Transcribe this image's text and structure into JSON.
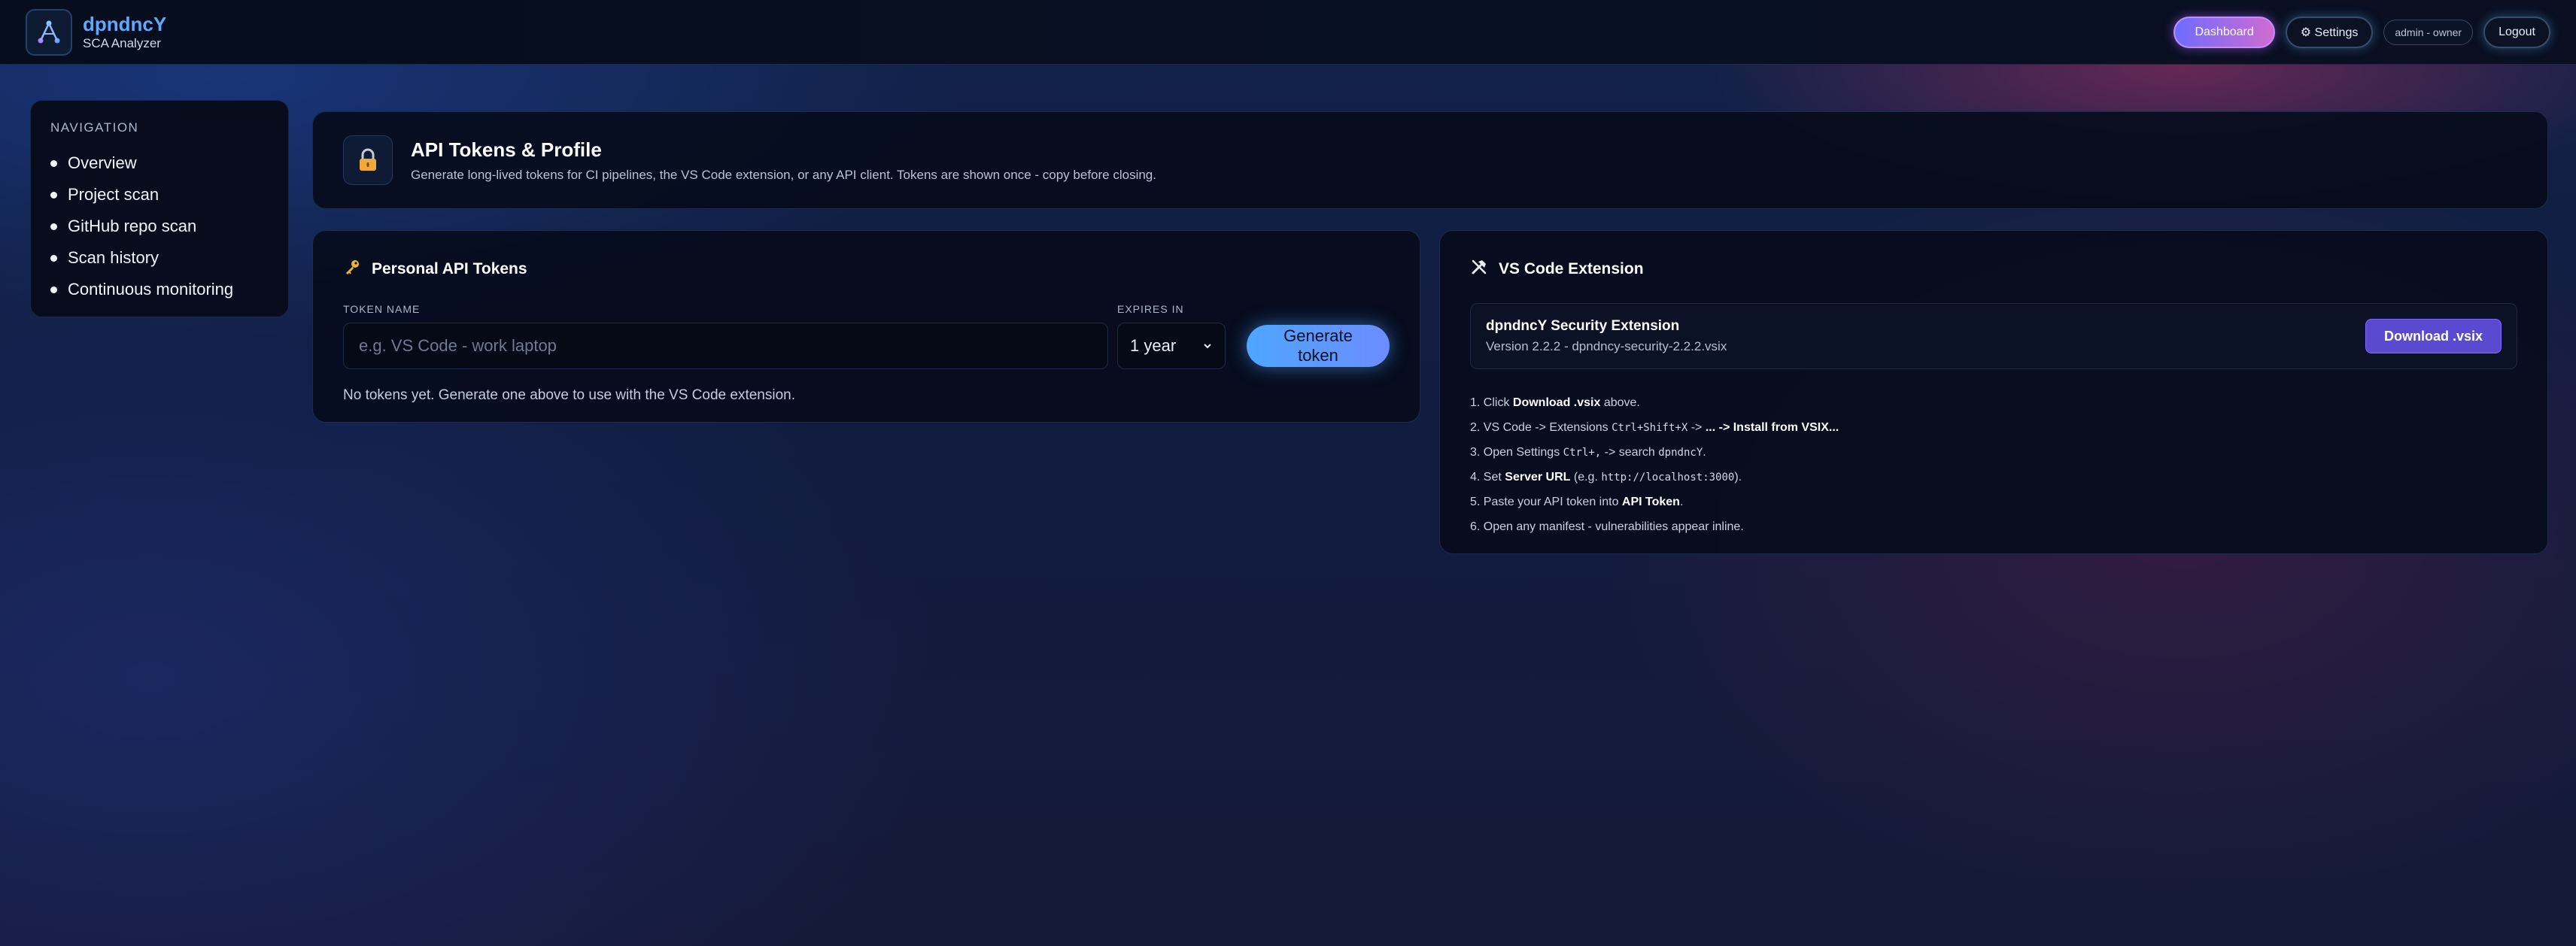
{
  "app": {
    "name": "dpndncY",
    "subtitle": "SCA Analyzer",
    "accent_color": "#5ea8ff"
  },
  "header_actions": {
    "dashboard_label": "Dashboard",
    "settings_label": "⚙ Settings",
    "user_label": "admin - owner",
    "logout_label": "Logout"
  },
  "sidebar": {
    "heading": "NAVIGATION",
    "items": [
      {
        "label": "Overview"
      },
      {
        "label": "Project scan"
      },
      {
        "label": "GitHub repo scan"
      },
      {
        "label": "Scan history"
      },
      {
        "label": "Continuous monitoring"
      }
    ]
  },
  "page_header": {
    "icon": "lock-icon",
    "title": "API Tokens & Profile",
    "subtitle": "Generate long-lived tokens for CI pipelines, the VS Code extension, or any API client. Tokens are shown once - copy before closing."
  },
  "tokens_panel": {
    "icon": "key-icon",
    "title": "Personal API Tokens",
    "token_name_label": "TOKEN NAME",
    "token_name_placeholder": "e.g. VS Code - work laptop",
    "token_name_value": "",
    "expires_label": "EXPIRES IN",
    "expires_value": "1 year",
    "generate_label": "Generate token",
    "empty_text": "No tokens yet. Generate one above to use with the VS Code extension."
  },
  "vscode_panel": {
    "icon": "tools-icon",
    "title": "VS Code Extension",
    "extension_name": "dpndncY Security Extension",
    "extension_version": "Version 2.2.2 - dpndncy-security-2.2.2.vsix",
    "download_label": "Download .vsix",
    "steps": [
      {
        "n": "1. ",
        "a": "Click ",
        "b": "Download .vsix",
        "c": " above.",
        "code": "",
        "d": ""
      },
      {
        "n": "2. ",
        "a": "VS Code -> Extensions ",
        "code": "Ctrl+Shift+X",
        "c": " -> ",
        "b": "... -> Install from VSIX...",
        "d": ""
      },
      {
        "n": "3. ",
        "a": "Open Settings ",
        "code": "Ctrl+,",
        "c": " -> search ",
        "code2": "dpndncY",
        "d": "."
      },
      {
        "n": "4. ",
        "a": "Set ",
        "b": "Server URL",
        "c": " (e.g. ",
        "code": "http://localhost:3000",
        "d": ")."
      },
      {
        "n": "5. ",
        "a": "Paste your API token into ",
        "b": "API Token",
        "c": ".",
        "code": "",
        "d": ""
      },
      {
        "n": "6. ",
        "a": "Open any manifest - vulnerabilities appear inline.",
        "b": "",
        "c": "",
        "code": "",
        "d": ""
      }
    ]
  }
}
